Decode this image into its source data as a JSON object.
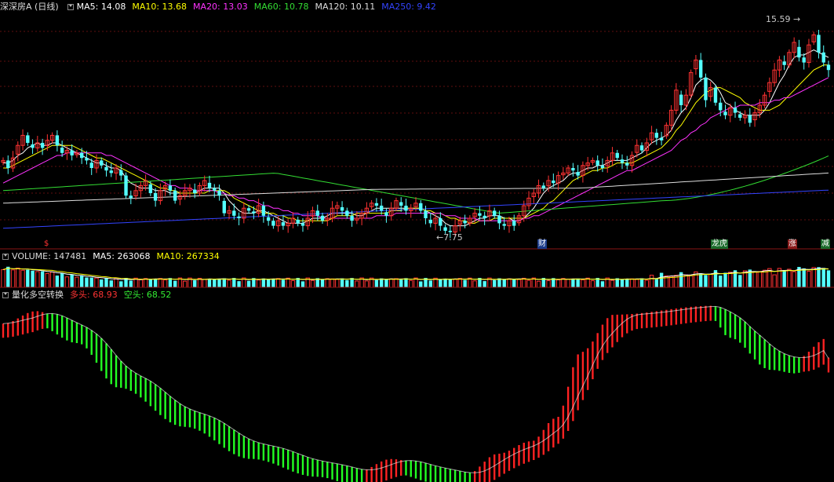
{
  "header": {
    "title": "深深房A (日线)",
    "ma": [
      {
        "label": "MA5: 14.08",
        "color": "#ffffff"
      },
      {
        "label": "MA10: 13.68",
        "color": "#ffff00"
      },
      {
        "label": "MA20: 13.03",
        "color": "#ff33ff"
      },
      {
        "label": "MA60: 10.78",
        "color": "#33dd33"
      },
      {
        "label": "MA120: 10.11",
        "color": "#dddddd"
      },
      {
        "label": "MA250: 9.42",
        "color": "#3344ff"
      }
    ]
  },
  "volume_header": {
    "volume": "VOLUME: 147481",
    "ma5": "MA5: 263068",
    "ma10": "MA10: 267334"
  },
  "indicator_header": {
    "name": "量化多空转换",
    "long": "多头: 68.93",
    "short": "空头: 68.52"
  },
  "annotations": {
    "high": "15.59",
    "low": "7.75",
    "markers": [
      {
        "text": "$",
        "color": "#ff3333",
        "bg": "none"
      },
      {
        "text": "财",
        "color": "#ffffff",
        "bg": "#1a3a8a"
      },
      {
        "text": "龙虎",
        "color": "#ffffff",
        "bg": "#1a6a2a"
      },
      {
        "text": "涨",
        "color": "#ffffff",
        "bg": "#8a1a1a"
      },
      {
        "text": "减",
        "color": "#ffffff",
        "bg": "#1a6a2a"
      }
    ]
  },
  "chart_data": {
    "type": "candlestick",
    "price_range": [
      7.3,
      16.3
    ],
    "closes": [
      10.6,
      10.3,
      10.7,
      11.2,
      11.6,
      11.3,
      11.1,
      11.3,
      11.1,
      11.4,
      11.6,
      11.2,
      10.9,
      11.0,
      10.8,
      10.9,
      10.7,
      10.6,
      10.3,
      10.6,
      10.4,
      10.2,
      10.1,
      10.3,
      10.0,
      9.2,
      9.1,
      9.4,
      9.6,
      9.8,
      9.3,
      9.0,
      9.4,
      9.6,
      9.4,
      9.0,
      9.2,
      9.4,
      9.5,
      9.3,
      9.6,
      9.8,
      9.5,
      9.4,
      9.2,
      8.5,
      8.6,
      8.4,
      8.3,
      8.7,
      8.6,
      8.5,
      8.8,
      8.4,
      8.2,
      8.0,
      8.2,
      8.0,
      8.1,
      8.3,
      8.1,
      8.0,
      8.3,
      8.6,
      8.4,
      8.2,
      8.3,
      8.7,
      8.8,
      8.6,
      8.4,
      8.2,
      8.3,
      8.5,
      8.7,
      8.9,
      8.8,
      8.6,
      8.4,
      8.7,
      9.0,
      8.8,
      8.6,
      8.7,
      8.9,
      8.6,
      8.3,
      8.1,
      8.3,
      8.0,
      7.8,
      7.75,
      8.0,
      8.2,
      8.1,
      8.3,
      8.5,
      8.4,
      8.3,
      8.6,
      8.4,
      8.1,
      8.0,
      8.2,
      8.0,
      8.4,
      8.8,
      9.1,
      9.3,
      9.6,
      9.5,
      9.8,
      9.7,
      10.0,
      10.1,
      10.3,
      10.2,
      10.0,
      10.4,
      10.5,
      10.6,
      10.4,
      10.3,
      10.6,
      10.9,
      10.7,
      10.5,
      10.4,
      10.8,
      11.2,
      11.0,
      11.3,
      11.7,
      11.5,
      11.4,
      12.0,
      12.6,
      13.4,
      12.8,
      13.2,
      14.1,
      14.6,
      13.9,
      13.0,
      13.5,
      12.9,
      12.6,
      12.4,
      12.7,
      12.5,
      12.3,
      12.4,
      12.1,
      12.5,
      12.8,
      13.2,
      13.7,
      14.2,
      14.6,
      14.4,
      14.9,
      15.3,
      14.7,
      14.5,
      15.2,
      15.6,
      14.9,
      14.5,
      14.2
    ],
    "ma5": [
      10.5,
      10.5,
      10.6,
      10.8,
      10.9,
      11.1,
      11.2,
      11.3,
      11.2,
      11.2,
      11.3,
      11.3,
      11.2,
      11.1,
      11.0,
      10.9,
      10.8,
      10.7,
      10.6,
      10.5,
      10.5,
      10.4,
      10.3,
      10.3,
      10.2,
      9.9,
      9.7,
      9.6,
      9.5,
      9.5,
      9.5,
      9.4,
      9.4,
      9.4,
      9.3,
      9.3,
      9.3,
      9.3,
      9.3,
      9.3,
      9.4,
      9.5,
      9.5,
      9.5,
      9.5,
      9.3,
      9.0,
      8.8,
      8.6,
      8.5,
      8.5,
      8.5,
      8.6,
      8.6,
      8.5,
      8.4,
      8.3,
      8.2,
      8.1,
      8.1,
      8.1,
      8.1,
      8.2,
      8.3,
      8.3,
      8.3,
      8.4,
      8.5,
      8.5,
      8.5,
      8.5,
      8.5,
      8.4,
      8.4,
      8.5,
      8.6,
      8.7,
      8.7,
      8.7,
      8.7,
      8.7,
      8.7,
      8.7,
      8.7,
      8.7,
      8.7,
      8.6,
      8.5,
      8.4,
      8.3,
      8.1,
      8.0,
      8.0,
      8.0,
      8.0,
      8.1,
      8.2,
      8.3,
      8.3,
      8.4,
      8.4,
      8.4,
      8.3,
      8.3,
      8.2,
      8.2,
      8.3,
      8.5,
      8.7,
      9.0,
      9.3,
      9.5,
      9.6,
      9.7,
      9.8,
      10.0,
      10.1,
      10.1,
      10.2,
      10.3,
      10.3,
      10.4,
      10.4,
      10.5,
      10.6,
      10.6,
      10.6,
      10.6,
      10.7,
      10.8,
      10.9,
      11.1,
      11.3,
      11.4,
      11.5,
      11.6,
      11.8,
      12.2,
      12.5,
      12.7,
      13.1,
      13.6,
      13.8,
      13.9,
      13.8,
      13.6,
      13.3,
      12.9,
      12.8,
      12.6,
      12.5,
      12.4,
      12.4,
      12.4,
      12.4,
      12.6,
      12.9,
      13.3,
      13.7,
      14.0,
      14.4,
      14.7,
      14.8,
      14.8,
      14.9,
      15.0,
      14.9,
      14.8,
      14.7
    ],
    "ma10": [
      10.3,
      10.3,
      10.4,
      10.5,
      10.6,
      10.7,
      10.8,
      10.9,
      11.0,
      11.1,
      11.2,
      11.2,
      11.2,
      11.2,
      11.2,
      11.1,
      11.0,
      10.9,
      10.8,
      10.7,
      10.7,
      10.6,
      10.5,
      10.4,
      10.3,
      10.2,
      10.1,
      10.0,
      9.9,
      9.8,
      9.7,
      9.6,
      9.5,
      9.5,
      9.4,
      9.4,
      9.3,
      9.3,
      9.3,
      9.3,
      9.3,
      9.3,
      9.4,
      9.4,
      9.4,
      9.4,
      9.3,
      9.1,
      9.0,
      8.9,
      8.8,
      8.7,
      8.6,
      8.5,
      8.5,
      8.5,
      8.4,
      8.4,
      8.3,
      8.3,
      8.2,
      8.2,
      8.2,
      8.2,
      8.2,
      8.2,
      8.2,
      8.3,
      8.4,
      8.4,
      8.4,
      8.4,
      8.5,
      8.5,
      8.5,
      8.5,
      8.5,
      8.5,
      8.5,
      8.6,
      8.6,
      8.6,
      8.7,
      8.7,
      8.7,
      8.7,
      8.6,
      8.6,
      8.5,
      8.5,
      8.4,
      8.3,
      8.3,
      8.2,
      8.2,
      8.1,
      8.1,
      8.2,
      8.2,
      8.2,
      8.3,
      8.3,
      8.3,
      8.3,
      8.3,
      8.3,
      8.3,
      8.4,
      8.5,
      8.6,
      8.7,
      8.9,
      9.0,
      9.2,
      9.4,
      9.6,
      9.8,
      9.9,
      10.0,
      10.1,
      10.2,
      10.2,
      10.3,
      10.3,
      10.4,
      10.5,
      10.5,
      10.5,
      10.5,
      10.6,
      10.7,
      10.8,
      10.9,
      11.0,
      11.1,
      11.3,
      11.5,
      11.8,
      12.0,
      12.3,
      12.6,
      12.9,
      13.1,
      13.3,
      13.4,
      13.5,
      13.5,
      13.4,
      13.3,
      13.2,
      13.1,
      12.9,
      12.8,
      12.7,
      12.6,
      12.6,
      12.6,
      12.7,
      12.8,
      13.0,
      13.2,
      13.4,
      13.6,
      13.8,
      14.0,
      14.2,
      14.3,
      14.4,
      14.4
    ],
    "ma20": [
      9.7,
      9.8,
      9.9,
      10.0,
      10.1,
      10.2,
      10.3,
      10.4,
      10.5,
      10.6,
      10.7,
      10.8,
      10.8,
      10.9,
      10.9,
      10.9,
      10.9,
      10.9,
      10.9,
      10.9,
      10.9,
      10.8,
      10.8,
      10.7,
      10.6,
      10.5,
      10.4,
      10.3,
      10.2,
      10.1,
      10.0,
      9.9,
      9.8,
      9.7,
      9.6,
      9.6,
      9.5,
      9.5,
      9.5,
      9.4,
      9.4,
      9.4,
      9.4,
      9.4,
      9.3,
      9.3,
      9.2,
      9.2,
      9.1,
      9.1,
      9.0,
      9.0,
      8.9,
      8.8,
      8.8,
      8.7,
      8.7,
      8.6,
      8.6,
      8.5,
      8.5,
      8.4,
      8.4,
      8.4,
      8.4,
      8.3,
      8.3,
      8.3,
      8.3,
      8.3,
      8.3,
      8.3,
      8.3,
      8.3,
      8.3,
      8.3,
      8.4,
      8.4,
      8.4,
      8.4,
      8.5,
      8.5,
      8.5,
      8.5,
      8.5,
      8.5,
      8.5,
      8.5,
      8.5,
      8.5,
      8.4,
      8.4,
      8.4,
      8.3,
      8.3,
      8.3,
      8.3,
      8.2,
      8.2,
      8.2,
      8.2,
      8.2,
      8.2,
      8.2,
      8.2,
      8.2,
      8.3,
      8.3,
      8.4,
      8.4,
      8.5,
      8.6,
      8.7,
      8.8,
      8.9,
      9.0,
      9.1,
      9.2,
      9.3,
      9.4,
      9.5,
      9.6,
      9.7,
      9.8,
      9.9,
      10.0,
      10.1,
      10.2,
      10.2,
      10.3,
      10.4,
      10.5,
      10.6,
      10.7,
      10.8,
      10.9,
      11.0,
      11.2,
      11.4,
      11.5,
      11.7,
      11.8,
      12.0,
      12.1,
      12.3,
      12.4,
      12.5,
      12.6,
      12.7,
      12.7,
      12.8,
      12.8,
      12.8,
      12.8,
      12.9,
      12.9,
      12.9,
      13.0,
      13.0,
      13.1,
      13.1,
      13.2,
      13.3,
      13.4,
      13.5,
      13.6,
      13.7,
      13.8,
      13.9
    ],
    "ma60_range": [
      9.1,
      10.78
    ],
    "ma120_range": [
      9.2,
      10.11
    ],
    "ma250_range": [
      7.9,
      9.42
    ],
    "indicator_range": [
      0,
      100
    ],
    "indicator_long_end": 68.93,
    "indicator_short_end": 68.52
  }
}
